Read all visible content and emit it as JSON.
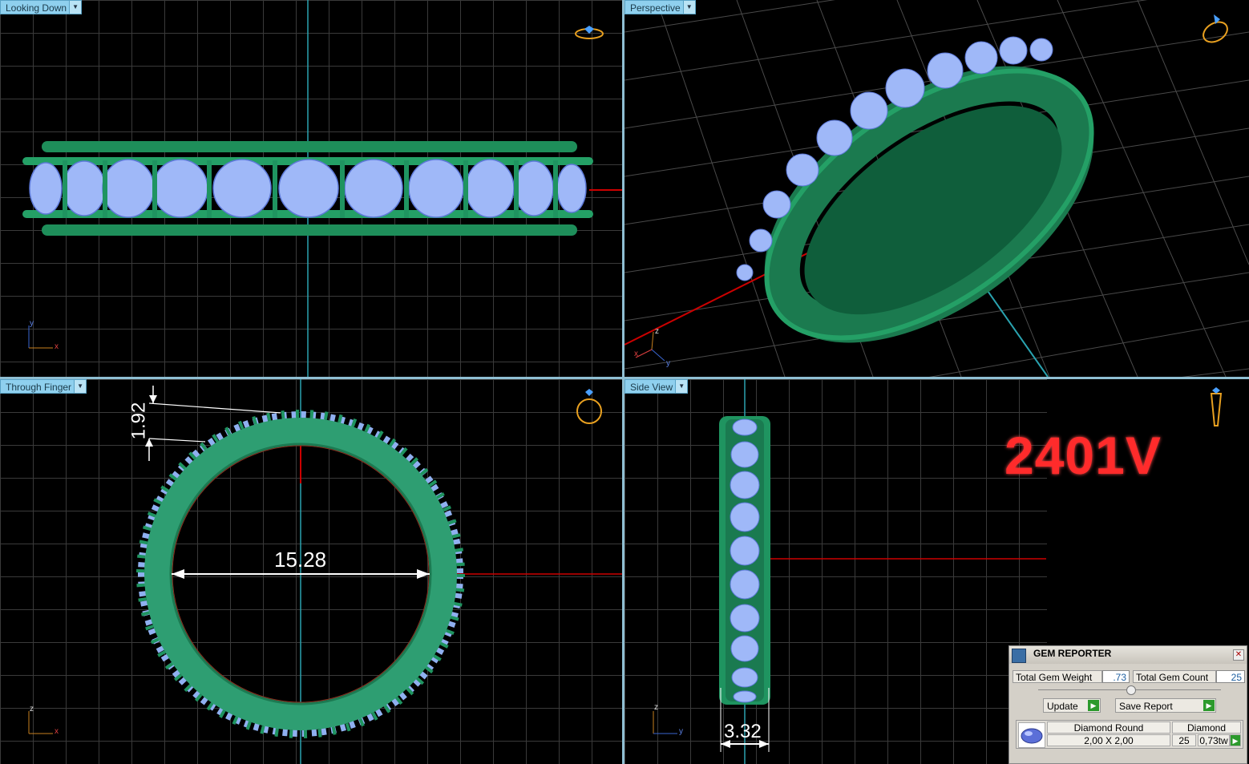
{
  "viewports": {
    "top_left": {
      "label": "Looking Down",
      "axis1": "y",
      "axis2": "x"
    },
    "top_right": {
      "label": "Perspective",
      "axis1": "z",
      "axis2": "x",
      "axis3": "y"
    },
    "bottom_left": {
      "label": "Through Finger",
      "axis1": "z",
      "axis2": "x"
    },
    "bottom_right": {
      "label": "Side View",
      "axis1": "z",
      "axis2": "y"
    }
  },
  "dimensions": {
    "height": "1.92",
    "inner_diameter": "15.28",
    "width": "3.32"
  },
  "model_code": "2401V",
  "gem_reporter": {
    "title": "GEM REPORTER",
    "total_weight_label": "Total Gem Weight",
    "total_weight_value": ".73",
    "total_count_label": "Total Gem Count",
    "total_count_value": "25",
    "update_label": "Update",
    "save_label": "Save Report",
    "gem": {
      "name": "Diamond Round",
      "size": "2,00 X 2,00",
      "material": "Diamond",
      "count": "25",
      "weight": "0,73tw"
    }
  },
  "colors": {
    "metal": "#2a9a6a",
    "gem": "#8fb0f0",
    "model_code": "#ff2b2b",
    "tab": "#8fd0ee"
  }
}
